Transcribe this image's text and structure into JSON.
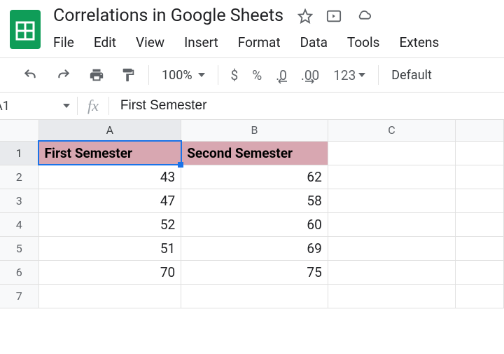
{
  "doc": {
    "title": "Correlations in Google Sheets"
  },
  "menubar": {
    "file": "File",
    "edit": "Edit",
    "view": "View",
    "insert": "Insert",
    "format": "Format",
    "data": "Data",
    "tools": "Tools",
    "extensions": "Extens"
  },
  "toolbar": {
    "zoom": "100%",
    "currency": "$",
    "percent": "%",
    "dec_dec": ".0",
    "inc_dec": ".00",
    "more_formats": "123",
    "font": "Default"
  },
  "formula_bar": {
    "cell_ref": "A1",
    "fx_label": "fx",
    "value": "First Semester"
  },
  "columns": {
    "A": "A",
    "B": "B",
    "C": "C"
  },
  "rows": {
    "1": "1",
    "2": "2",
    "3": "3",
    "4": "4",
    "5": "5",
    "6": "6",
    "7": "7"
  },
  "sheet": {
    "headers": {
      "A": "First Semester",
      "B": "Second Semester"
    },
    "data": [
      {
        "A": "43",
        "B": "62"
      },
      {
        "A": "47",
        "B": "58"
      },
      {
        "A": "52",
        "B": "60"
      },
      {
        "A": "51",
        "B": "69"
      },
      {
        "A": "70",
        "B": "75"
      }
    ]
  },
  "selection": {
    "active_cell": "A1"
  }
}
